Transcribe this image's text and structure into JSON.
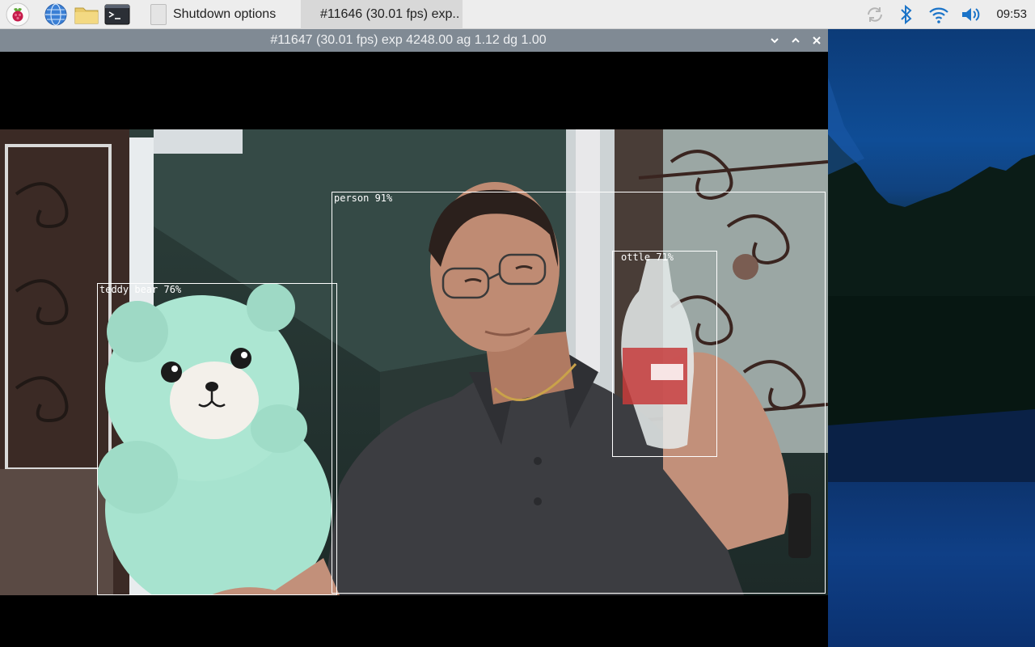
{
  "taskbar": {
    "launchers": [
      {
        "icon": "raspberry-pi-menu-icon"
      },
      {
        "icon": "web-browser-globe-icon"
      },
      {
        "icon": "file-manager-folder-icon"
      },
      {
        "icon": "terminal-icon"
      }
    ],
    "tasks": [
      {
        "label": "Shutdown options",
        "active": false
      },
      {
        "label": "#11646 (30.01 fps) exp..",
        "active": true
      }
    ],
    "tray": [
      {
        "icon": "updates-sync-icon"
      },
      {
        "icon": "bluetooth-icon"
      },
      {
        "icon": "wifi-icon"
      },
      {
        "icon": "volume-icon"
      }
    ],
    "clock": "09:53"
  },
  "window": {
    "title": "#11647 (30.01 fps) exp 4248.00 ag 1.12 dg 1.00",
    "buttons": [
      "minimize",
      "maximize",
      "close"
    ]
  },
  "detections": [
    {
      "label": "person 91%"
    },
    {
      "label": "teddy bear 76%"
    },
    {
      "label": "ottle 71%"
    }
  ],
  "colors": {
    "taskbar_bg": "#ededed",
    "titlebar_bg": "#808a94",
    "tray_blue": "#1a73c8",
    "teddy": "#a7e3cf"
  }
}
